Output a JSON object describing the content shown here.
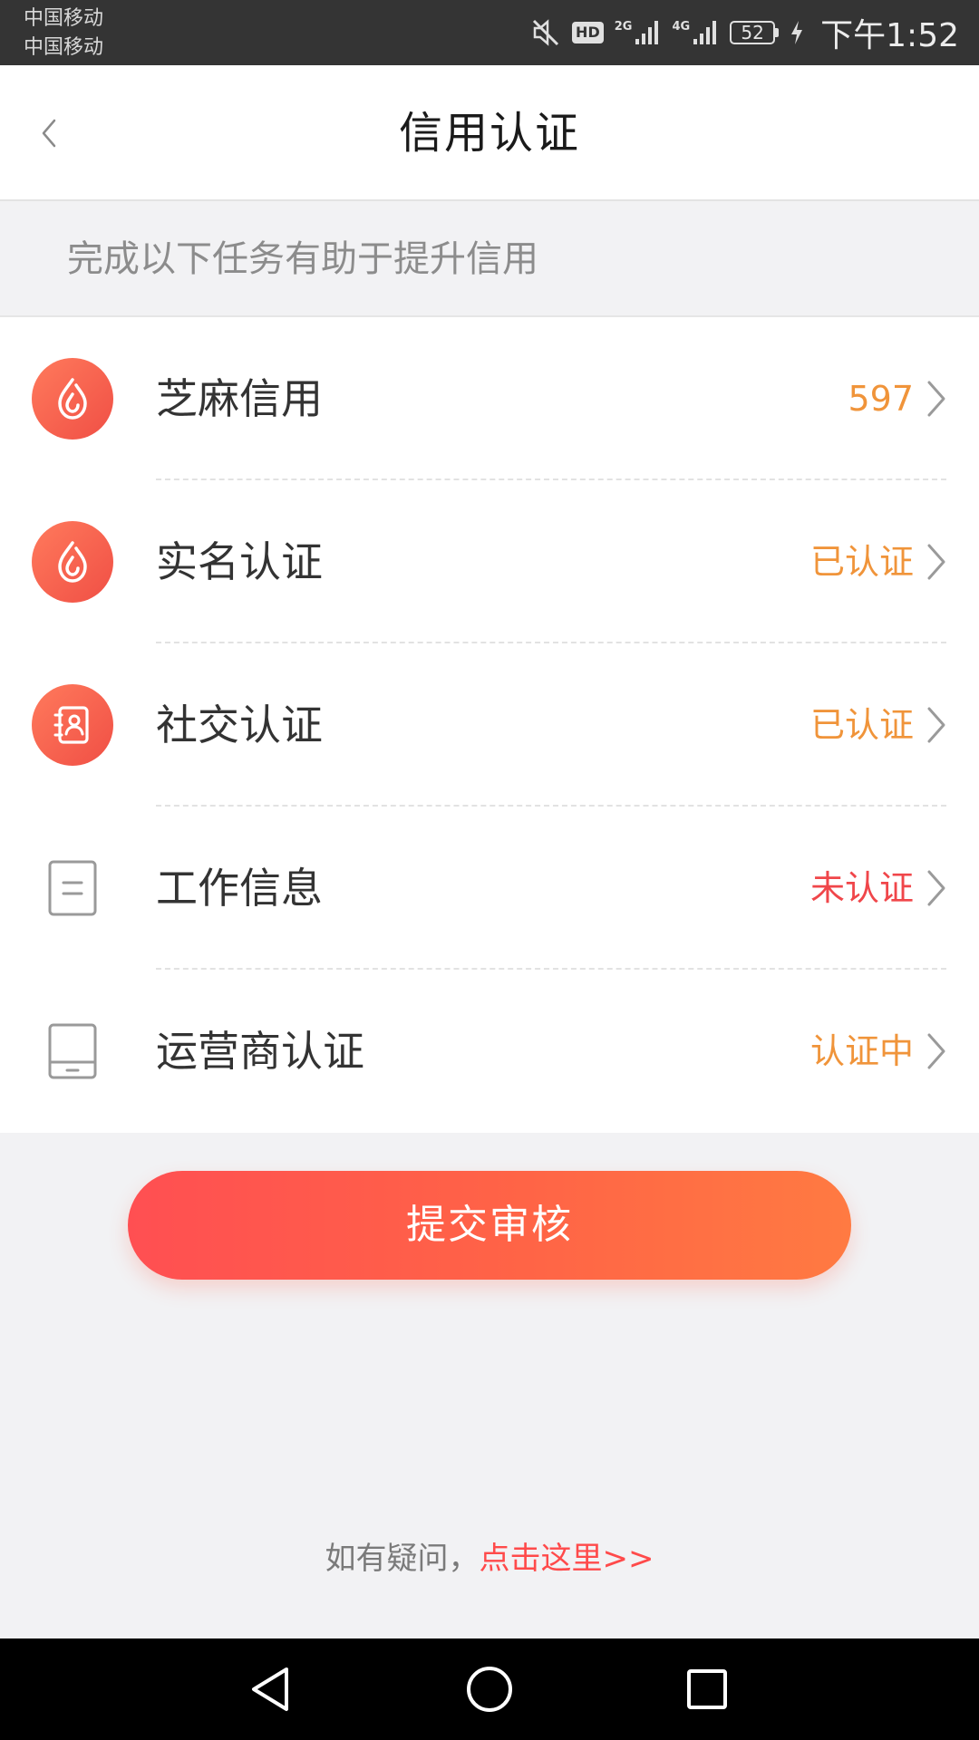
{
  "status_bar": {
    "carrier_1": "中国移动",
    "carrier_2": "中国移动",
    "hd_badge": "HD",
    "net_1": "2G",
    "net_2": "4G",
    "battery_level": "52",
    "time": "下午1:52",
    "icons": [
      "mute-icon",
      "signal-icon",
      "charging-icon"
    ]
  },
  "header": {
    "title": "信用认证",
    "back_icon": "chevron-left-icon"
  },
  "hint": "完成以下任务有助于提升信用",
  "items": [
    {
      "label": "芝麻信用",
      "status": "597",
      "status_color": "#f0943a",
      "icon": "sesame-drop-icon"
    },
    {
      "label": "实名认证",
      "status": "已认证",
      "status_color": "#f0943a",
      "icon": "sesame-drop-icon"
    },
    {
      "label": "社交认证",
      "status": "已认证",
      "status_color": "#f0943a",
      "icon": "contact-book-icon"
    },
    {
      "label": "工作信息",
      "status": "未认证",
      "status_color": "#f0464a",
      "icon": "document-icon"
    },
    {
      "label": "运营商认证",
      "status": "认证中",
      "status_color": "#f0943a",
      "icon": "phone-device-icon"
    }
  ],
  "submit": {
    "label": "提交审核"
  },
  "help": {
    "prefix": "如有疑问，",
    "link": "点击这里>>"
  },
  "nav": {
    "icons": [
      "back-triangle-icon",
      "home-circle-icon",
      "recents-square-icon"
    ]
  },
  "colors": {
    "accent": "#ff5a4c",
    "status_done": "#f0943a",
    "status_pending": "#f0464a"
  }
}
